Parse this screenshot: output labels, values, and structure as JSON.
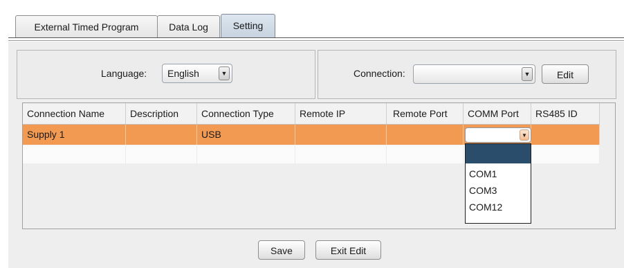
{
  "tabs": [
    {
      "label": "External Timed Program"
    },
    {
      "label": "Data Log"
    },
    {
      "label": "Setting",
      "active": true
    }
  ],
  "settings": {
    "language_label": "Language:",
    "language_value": "English",
    "connection_label": "Connection:",
    "connection_value": "",
    "edit_label": "Edit"
  },
  "table": {
    "columns": [
      "Connection Name",
      "Description",
      "Connection Type",
      "Remote IP",
      "Remote Port",
      "COMM Port",
      "RS485 ID"
    ],
    "rows": [
      {
        "name": "Supply 1",
        "description": "",
        "type": "USB",
        "remote_ip": "",
        "remote_port": "",
        "comm_port": "",
        "rs485_id": ""
      }
    ],
    "selected_row_color": "#f39a52"
  },
  "comm_dropdown": {
    "options": [
      "",
      "COM1",
      "COM3",
      "COM12"
    ],
    "highlighted_color": "#2a4d6b"
  },
  "footer": {
    "save_label": "Save",
    "exit_label": "Exit Edit"
  },
  "icons": {
    "combo_arrow": "chevron-down-icon"
  }
}
